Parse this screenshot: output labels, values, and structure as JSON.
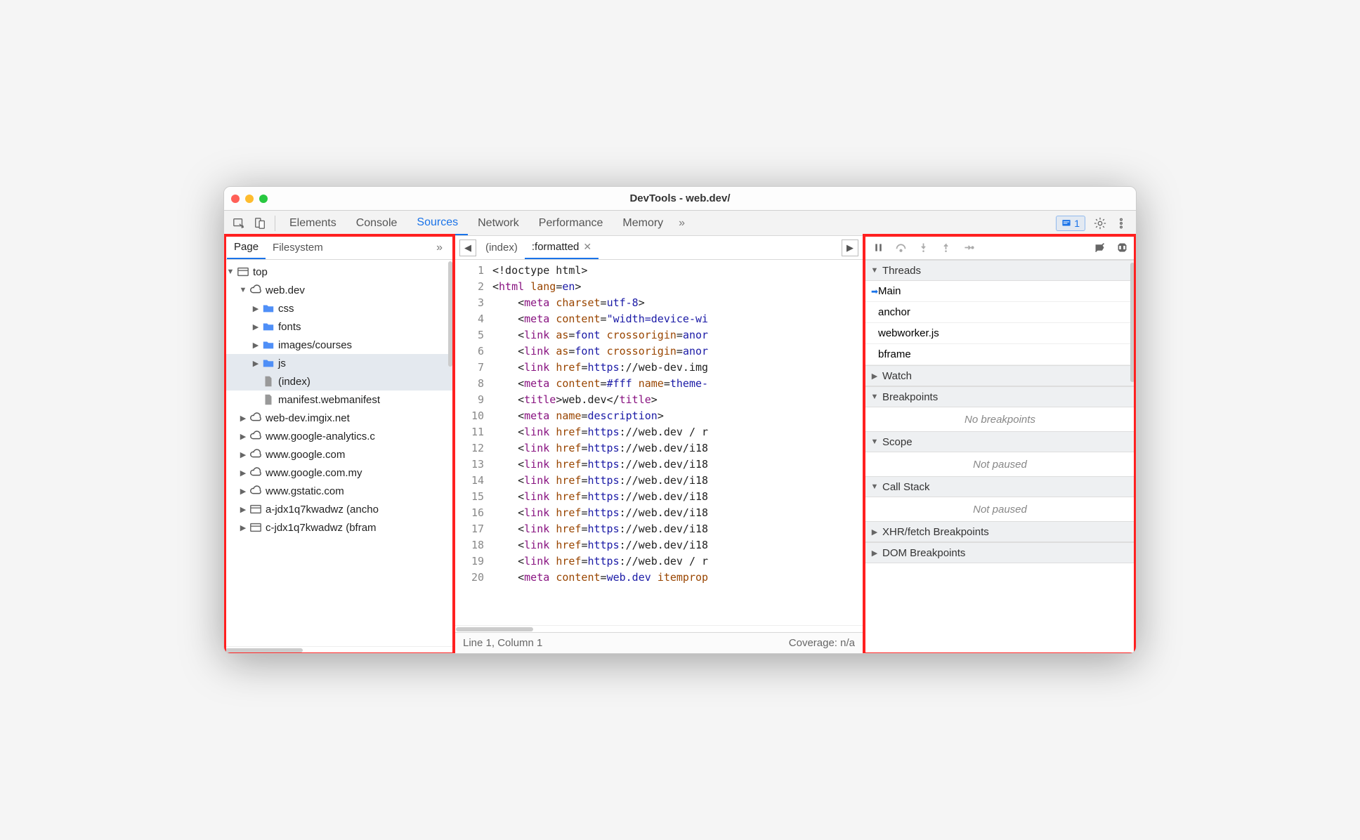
{
  "window": {
    "title": "DevTools - web.dev/"
  },
  "toolbar": {
    "tabs": [
      "Elements",
      "Console",
      "Sources",
      "Network",
      "Performance",
      "Memory"
    ],
    "active_tab": "Sources",
    "badge_count": "1"
  },
  "sidebar": {
    "tabs": [
      "Page",
      "Filesystem"
    ],
    "active_tab": "Page",
    "tree": [
      {
        "depth": 0,
        "expand": "▼",
        "icon": "window",
        "label": "top"
      },
      {
        "depth": 1,
        "expand": "▼",
        "icon": "cloud",
        "label": "web.dev"
      },
      {
        "depth": 2,
        "expand": "▶",
        "icon": "folder",
        "label": "css"
      },
      {
        "depth": 2,
        "expand": "▶",
        "icon": "folder",
        "label": "fonts"
      },
      {
        "depth": 2,
        "expand": "▶",
        "icon": "folder",
        "label": "images/courses"
      },
      {
        "depth": 2,
        "expand": "▶",
        "icon": "folder",
        "label": "js",
        "selected": true
      },
      {
        "depth": 2,
        "expand": "",
        "icon": "file",
        "label": "(index)",
        "selected_file": true
      },
      {
        "depth": 2,
        "expand": "",
        "icon": "file",
        "label": "manifest.webmanifest"
      },
      {
        "depth": 1,
        "expand": "▶",
        "icon": "cloud",
        "label": "web-dev.imgix.net"
      },
      {
        "depth": 1,
        "expand": "▶",
        "icon": "cloud",
        "label": "www.google-analytics.c"
      },
      {
        "depth": 1,
        "expand": "▶",
        "icon": "cloud",
        "label": "www.google.com"
      },
      {
        "depth": 1,
        "expand": "▶",
        "icon": "cloud",
        "label": "www.google.com.my"
      },
      {
        "depth": 1,
        "expand": "▶",
        "icon": "cloud",
        "label": "www.gstatic.com"
      },
      {
        "depth": 1,
        "expand": "▶",
        "icon": "window",
        "label": "a-jdx1q7kwadwz (ancho"
      },
      {
        "depth": 1,
        "expand": "▶",
        "icon": "window",
        "label": "c-jdx1q7kwadwz (bfram"
      }
    ]
  },
  "editor": {
    "file_tabs": [
      {
        "label": "(index)",
        "active": false,
        "close": false
      },
      {
        "label": ":formatted",
        "active": true,
        "close": true
      }
    ],
    "lines": [
      [
        {
          "t": "txt",
          "v": "<!doctype html>"
        }
      ],
      [
        {
          "t": "txt",
          "v": "<"
        },
        {
          "t": "tag",
          "v": "html"
        },
        {
          "t": "txt",
          "v": " "
        },
        {
          "t": "attr",
          "v": "lang"
        },
        {
          "t": "txt",
          "v": "="
        },
        {
          "t": "val",
          "v": "en"
        },
        {
          "t": "txt",
          "v": ">"
        }
      ],
      [
        {
          "t": "txt",
          "v": "    <"
        },
        {
          "t": "tag",
          "v": "meta"
        },
        {
          "t": "txt",
          "v": " "
        },
        {
          "t": "attr",
          "v": "charset"
        },
        {
          "t": "txt",
          "v": "="
        },
        {
          "t": "val",
          "v": "utf-8"
        },
        {
          "t": "txt",
          "v": ">"
        }
      ],
      [
        {
          "t": "txt",
          "v": "    <"
        },
        {
          "t": "tag",
          "v": "meta"
        },
        {
          "t": "txt",
          "v": " "
        },
        {
          "t": "attr",
          "v": "content"
        },
        {
          "t": "txt",
          "v": "="
        },
        {
          "t": "val",
          "v": "\"width=device-wi"
        }
      ],
      [
        {
          "t": "txt",
          "v": "    <"
        },
        {
          "t": "tag",
          "v": "link"
        },
        {
          "t": "txt",
          "v": " "
        },
        {
          "t": "attr",
          "v": "as"
        },
        {
          "t": "txt",
          "v": "="
        },
        {
          "t": "val",
          "v": "font"
        },
        {
          "t": "txt",
          "v": " "
        },
        {
          "t": "attr",
          "v": "crossorigin"
        },
        {
          "t": "txt",
          "v": "="
        },
        {
          "t": "val",
          "v": "anor"
        }
      ],
      [
        {
          "t": "txt",
          "v": "    <"
        },
        {
          "t": "tag",
          "v": "link"
        },
        {
          "t": "txt",
          "v": " "
        },
        {
          "t": "attr",
          "v": "as"
        },
        {
          "t": "txt",
          "v": "="
        },
        {
          "t": "val",
          "v": "font"
        },
        {
          "t": "txt",
          "v": " "
        },
        {
          "t": "attr",
          "v": "crossorigin"
        },
        {
          "t": "txt",
          "v": "="
        },
        {
          "t": "val",
          "v": "anor"
        }
      ],
      [
        {
          "t": "txt",
          "v": "    <"
        },
        {
          "t": "tag",
          "v": "link"
        },
        {
          "t": "txt",
          "v": " "
        },
        {
          "t": "attr",
          "v": "href"
        },
        {
          "t": "txt",
          "v": "="
        },
        {
          "t": "val",
          "v": "https"
        },
        {
          "t": "txt",
          "v": "://web-dev.img"
        }
      ],
      [
        {
          "t": "txt",
          "v": "    <"
        },
        {
          "t": "tag",
          "v": "meta"
        },
        {
          "t": "txt",
          "v": " "
        },
        {
          "t": "attr",
          "v": "content"
        },
        {
          "t": "txt",
          "v": "="
        },
        {
          "t": "val",
          "v": "#fff"
        },
        {
          "t": "txt",
          "v": " "
        },
        {
          "t": "attr",
          "v": "name"
        },
        {
          "t": "txt",
          "v": "="
        },
        {
          "t": "val",
          "v": "theme-"
        }
      ],
      [
        {
          "t": "txt",
          "v": "    <"
        },
        {
          "t": "tag",
          "v": "title"
        },
        {
          "t": "txt",
          "v": ">web.dev</"
        },
        {
          "t": "tag",
          "v": "title"
        },
        {
          "t": "txt",
          "v": ">"
        }
      ],
      [
        {
          "t": "txt",
          "v": "    <"
        },
        {
          "t": "tag",
          "v": "meta"
        },
        {
          "t": "txt",
          "v": " "
        },
        {
          "t": "attr",
          "v": "name"
        },
        {
          "t": "txt",
          "v": "="
        },
        {
          "t": "val",
          "v": "description"
        },
        {
          "t": "txt",
          "v": ">"
        }
      ],
      [
        {
          "t": "txt",
          "v": "    <"
        },
        {
          "t": "tag",
          "v": "link"
        },
        {
          "t": "txt",
          "v": " "
        },
        {
          "t": "attr",
          "v": "href"
        },
        {
          "t": "txt",
          "v": "="
        },
        {
          "t": "val",
          "v": "https"
        },
        {
          "t": "txt",
          "v": "://web.dev / r"
        }
      ],
      [
        {
          "t": "txt",
          "v": "    <"
        },
        {
          "t": "tag",
          "v": "link"
        },
        {
          "t": "txt",
          "v": " "
        },
        {
          "t": "attr",
          "v": "href"
        },
        {
          "t": "txt",
          "v": "="
        },
        {
          "t": "val",
          "v": "https"
        },
        {
          "t": "txt",
          "v": "://web.dev/i18"
        }
      ],
      [
        {
          "t": "txt",
          "v": "    <"
        },
        {
          "t": "tag",
          "v": "link"
        },
        {
          "t": "txt",
          "v": " "
        },
        {
          "t": "attr",
          "v": "href"
        },
        {
          "t": "txt",
          "v": "="
        },
        {
          "t": "val",
          "v": "https"
        },
        {
          "t": "txt",
          "v": "://web.dev/i18"
        }
      ],
      [
        {
          "t": "txt",
          "v": "    <"
        },
        {
          "t": "tag",
          "v": "link"
        },
        {
          "t": "txt",
          "v": " "
        },
        {
          "t": "attr",
          "v": "href"
        },
        {
          "t": "txt",
          "v": "="
        },
        {
          "t": "val",
          "v": "https"
        },
        {
          "t": "txt",
          "v": "://web.dev/i18"
        }
      ],
      [
        {
          "t": "txt",
          "v": "    <"
        },
        {
          "t": "tag",
          "v": "link"
        },
        {
          "t": "txt",
          "v": " "
        },
        {
          "t": "attr",
          "v": "href"
        },
        {
          "t": "txt",
          "v": "="
        },
        {
          "t": "val",
          "v": "https"
        },
        {
          "t": "txt",
          "v": "://web.dev/i18"
        }
      ],
      [
        {
          "t": "txt",
          "v": "    <"
        },
        {
          "t": "tag",
          "v": "link"
        },
        {
          "t": "txt",
          "v": " "
        },
        {
          "t": "attr",
          "v": "href"
        },
        {
          "t": "txt",
          "v": "="
        },
        {
          "t": "val",
          "v": "https"
        },
        {
          "t": "txt",
          "v": "://web.dev/i18"
        }
      ],
      [
        {
          "t": "txt",
          "v": "    <"
        },
        {
          "t": "tag",
          "v": "link"
        },
        {
          "t": "txt",
          "v": " "
        },
        {
          "t": "attr",
          "v": "href"
        },
        {
          "t": "txt",
          "v": "="
        },
        {
          "t": "val",
          "v": "https"
        },
        {
          "t": "txt",
          "v": "://web.dev/i18"
        }
      ],
      [
        {
          "t": "txt",
          "v": "    <"
        },
        {
          "t": "tag",
          "v": "link"
        },
        {
          "t": "txt",
          "v": " "
        },
        {
          "t": "attr",
          "v": "href"
        },
        {
          "t": "txt",
          "v": "="
        },
        {
          "t": "val",
          "v": "https"
        },
        {
          "t": "txt",
          "v": "://web.dev/i18"
        }
      ],
      [
        {
          "t": "txt",
          "v": "    <"
        },
        {
          "t": "tag",
          "v": "link"
        },
        {
          "t": "txt",
          "v": " "
        },
        {
          "t": "attr",
          "v": "href"
        },
        {
          "t": "txt",
          "v": "="
        },
        {
          "t": "val",
          "v": "https"
        },
        {
          "t": "txt",
          "v": "://web.dev / r"
        }
      ],
      [
        {
          "t": "txt",
          "v": "    <"
        },
        {
          "t": "tag",
          "v": "meta"
        },
        {
          "t": "txt",
          "v": " "
        },
        {
          "t": "attr",
          "v": "content"
        },
        {
          "t": "txt",
          "v": "="
        },
        {
          "t": "val",
          "v": "web.dev"
        },
        {
          "t": "txt",
          "v": " "
        },
        {
          "t": "attr",
          "v": "itemprop"
        }
      ]
    ],
    "status_left": "Line 1, Column 1",
    "status_right": "Coverage: n/a"
  },
  "debugger": {
    "sections": {
      "threads": {
        "label": "Threads",
        "expanded": true,
        "items": [
          "Main",
          "anchor",
          "webworker.js",
          "bframe"
        ],
        "active": "Main"
      },
      "watch": {
        "label": "Watch",
        "expanded": false
      },
      "breakpoints": {
        "label": "Breakpoints",
        "expanded": true,
        "empty": "No breakpoints"
      },
      "scope": {
        "label": "Scope",
        "expanded": true,
        "empty": "Not paused"
      },
      "callstack": {
        "label": "Call Stack",
        "expanded": true,
        "empty": "Not paused"
      },
      "xhr": {
        "label": "XHR/fetch Breakpoints",
        "expanded": false
      },
      "dom": {
        "label": "DOM Breakpoints",
        "expanded": false
      }
    }
  }
}
